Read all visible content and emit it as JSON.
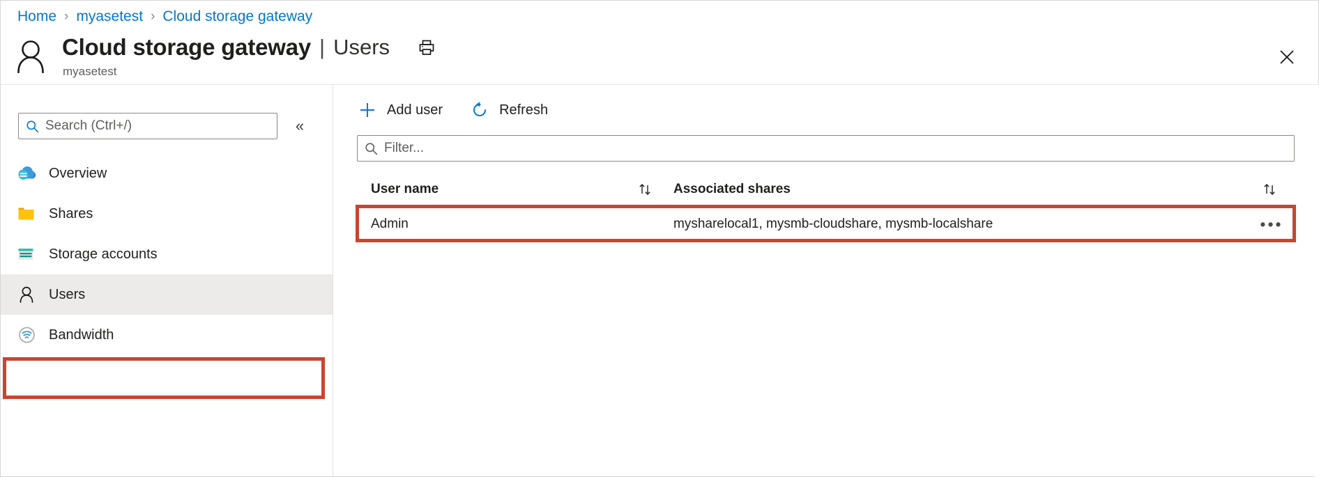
{
  "breadcrumb": {
    "name": "breadcrumb",
    "separator": "›",
    "items": [
      {
        "label": "Home"
      },
      {
        "label": "myasetest"
      },
      {
        "label": "Cloud storage gateway"
      }
    ]
  },
  "header": {
    "icon": "user-outline-icon",
    "title": "Cloud storage gateway",
    "divider": "|",
    "section": "Users",
    "subtitle": "myasetest",
    "print_icon": "printer-icon",
    "close_icon": "close-icon"
  },
  "sidebar": {
    "search": {
      "placeholder": "Search (Ctrl+/)",
      "value": "",
      "icon": "search-icon"
    },
    "collapse": {
      "label": "«",
      "icon": "chevron-double-left-icon"
    },
    "items": [
      {
        "label": "Overview",
        "icon": "cloud-icon",
        "selected": false
      },
      {
        "label": "Shares",
        "icon": "folder-icon",
        "selected": false
      },
      {
        "label": "Storage accounts",
        "icon": "storage-account-icon",
        "selected": false
      },
      {
        "label": "Users",
        "icon": "user-icon",
        "selected": true
      },
      {
        "label": "Bandwidth",
        "icon": "bandwidth-icon",
        "selected": false
      }
    ]
  },
  "toolbar": {
    "add_user_label": "Add user",
    "add_user_icon": "plus-icon",
    "refresh_label": "Refresh",
    "refresh_icon": "refresh-icon"
  },
  "filter": {
    "placeholder": "Filter...",
    "value": "",
    "icon": "search-icon"
  },
  "table": {
    "columns": [
      {
        "label": "User name",
        "sort_icon": "sort-arrows-icon"
      },
      {
        "label": "Associated shares",
        "sort_icon": "sort-arrows-icon"
      }
    ],
    "rows": [
      {
        "user_name": "Admin",
        "associated_shares": "mysharelocal1, mysmb-cloudshare, mysmb-localshare",
        "menu_icon": "ellipsis-icon",
        "menu_label": "•••"
      }
    ]
  },
  "annotations": {
    "highlight_color": "#c9452f",
    "targets": [
      "sidebar-item-users",
      "table-row-admin"
    ]
  },
  "colors": {
    "accent_blue": "#0078d4",
    "selected_bg": "#edebe9",
    "text": "#201f1e",
    "muted_text": "#605e5c",
    "highlight_red": "#c9452f"
  }
}
